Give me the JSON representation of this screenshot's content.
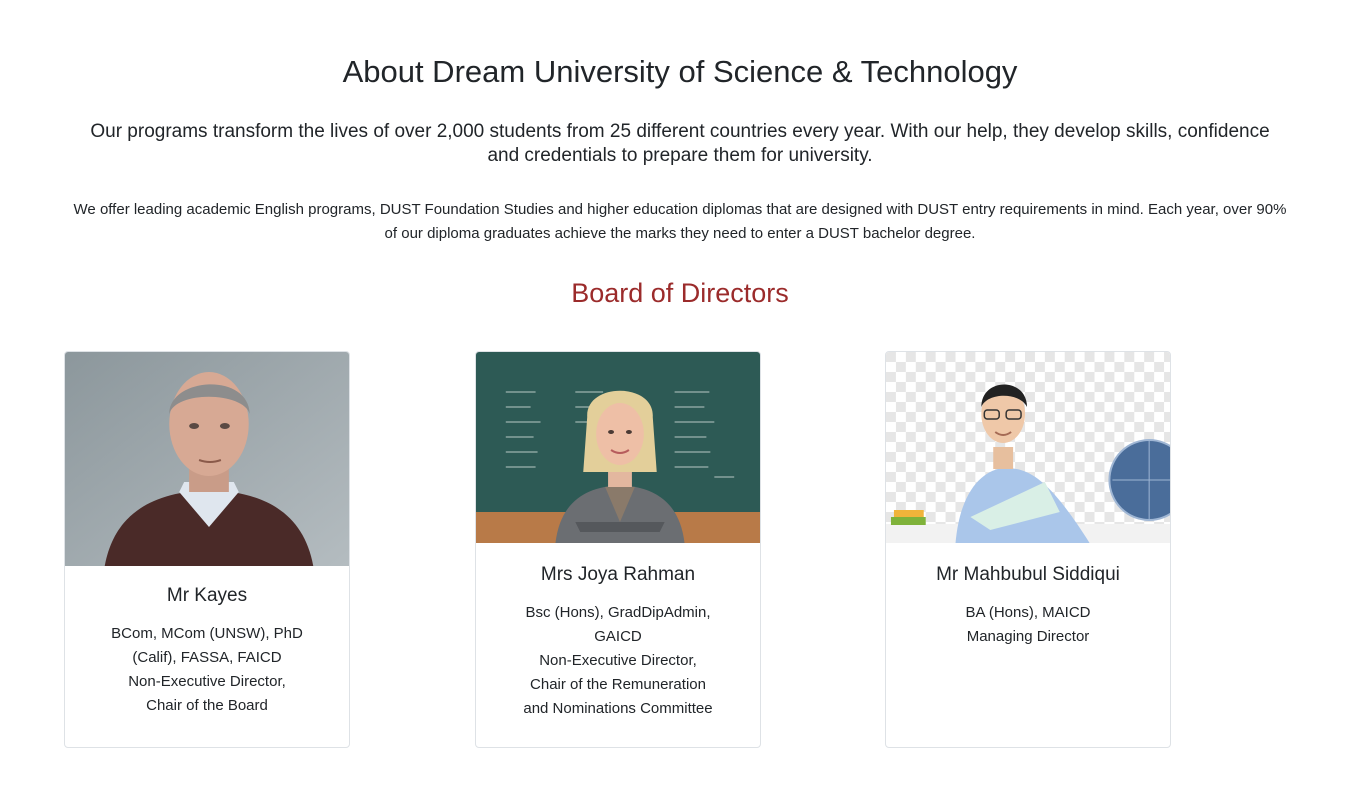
{
  "header": {
    "title": "About Dream University of Science & Technology",
    "lead": "Our programs transform the lives of over 2,000 students from 25 different countries every year. With our help, they develop skills, confidence and credentials to prepare them for university.",
    "body": "We offer leading academic English programs, DUST Foundation Studies and higher education diplomas that are designed with DUST entry requirements in mind. Each year, over 90% of our diploma graduates achieve the marks they need to enter a DUST bachelor degree."
  },
  "board": {
    "title": "Board of Directors",
    "title_color": "#9b2b2b",
    "members": [
      {
        "name": "Mr Kayes",
        "lines": [
          "BCom, MCom (UNSW), PhD (Calif), FASSA, FAICD",
          "Non-Executive Director,",
          "Chair of the Board"
        ]
      },
      {
        "name": "Mrs Joya Rahman",
        "lines": [
          "Bsc (Hons), GradDipAdmin, GAICD",
          "Non-Executive Director,",
          "Chair of the Remuneration and Nominations Committee"
        ]
      },
      {
        "name": "Mr Mahbubul Siddiqui",
        "lines": [
          "BA (Hons), MAICD",
          "Managing Director"
        ]
      }
    ]
  }
}
